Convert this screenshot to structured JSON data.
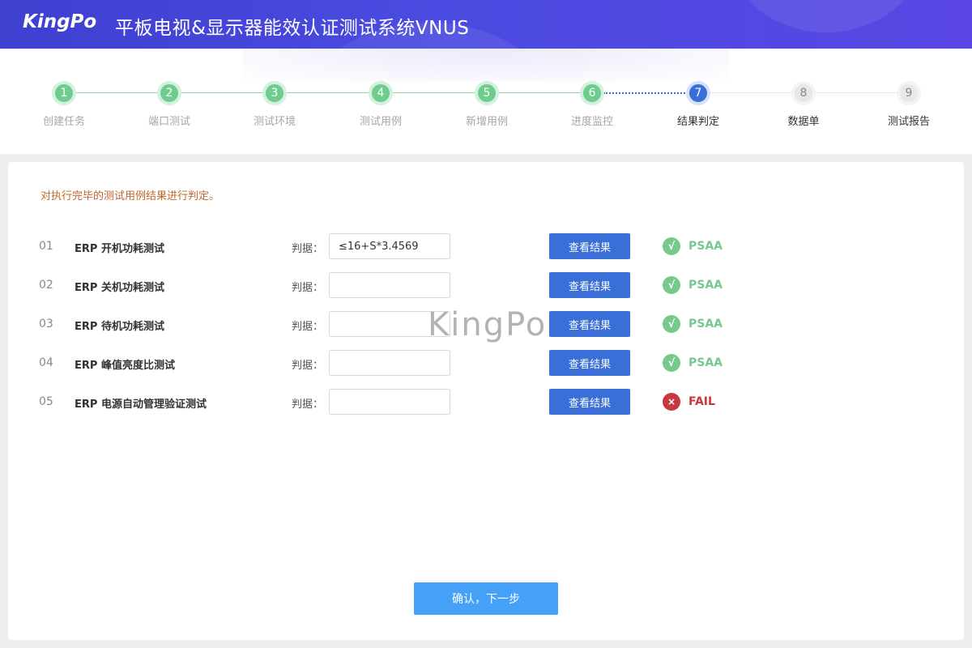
{
  "header": {
    "logo": "KingPo",
    "title": "平板电视&显示器能效认证测试系统VNUS"
  },
  "stepper": {
    "steps": [
      {
        "num": "1",
        "label": "创建任务",
        "state": "done"
      },
      {
        "num": "2",
        "label": "端口测试",
        "state": "done"
      },
      {
        "num": "3",
        "label": "测试环境",
        "state": "done"
      },
      {
        "num": "4",
        "label": "测试用例",
        "state": "done"
      },
      {
        "num": "5",
        "label": "新增用例",
        "state": "done"
      },
      {
        "num": "6",
        "label": "进度监控",
        "state": "done"
      },
      {
        "num": "7",
        "label": "结果判定",
        "state": "active"
      },
      {
        "num": "8",
        "label": "数据单",
        "state": "pending"
      },
      {
        "num": "9",
        "label": "测试报告",
        "state": "pending"
      }
    ]
  },
  "main": {
    "instruction": "对执行完毕的测试用例结果进行判定。",
    "criteria_label": "判据：",
    "view_button_label": "查看结果",
    "watermark": "KingPo",
    "rows": [
      {
        "idx": "01",
        "name": "ERP 开机功耗测试",
        "criteria": "≤16+S*3.4569",
        "result": "PSAA",
        "status": "pass",
        "icon": "√"
      },
      {
        "idx": "02",
        "name": "ERP 关机功耗测试",
        "criteria": "",
        "result": "PSAA",
        "status": "pass",
        "icon": "√"
      },
      {
        "idx": "03",
        "name": "ERP 待机功耗测试",
        "criteria": "",
        "result": "PSAA",
        "status": "pass",
        "icon": "√"
      },
      {
        "idx": "04",
        "name": "ERP 峰值亮度比测试",
        "criteria": "",
        "result": "PSAA",
        "status": "pass",
        "icon": "√"
      },
      {
        "idx": "05",
        "name": "ERP 电源自动管理验证测试",
        "criteria": "",
        "result": "FAIL",
        "status": "fail",
        "icon": "×"
      }
    ],
    "confirm_label": "确认，下一步"
  },
  "colors": {
    "header_gradient_start": "#3f3fd0",
    "header_gradient_end": "#5a47e3",
    "step_done": "#6fcc8f",
    "step_active": "#3a6fd8",
    "step_pending": "#e8e8e8",
    "primary_button": "#3a6fd8",
    "confirm_button": "#45a0f8",
    "pass": "#75c98d",
    "fail": "#c7383f",
    "instruction_text": "#c0672d"
  }
}
